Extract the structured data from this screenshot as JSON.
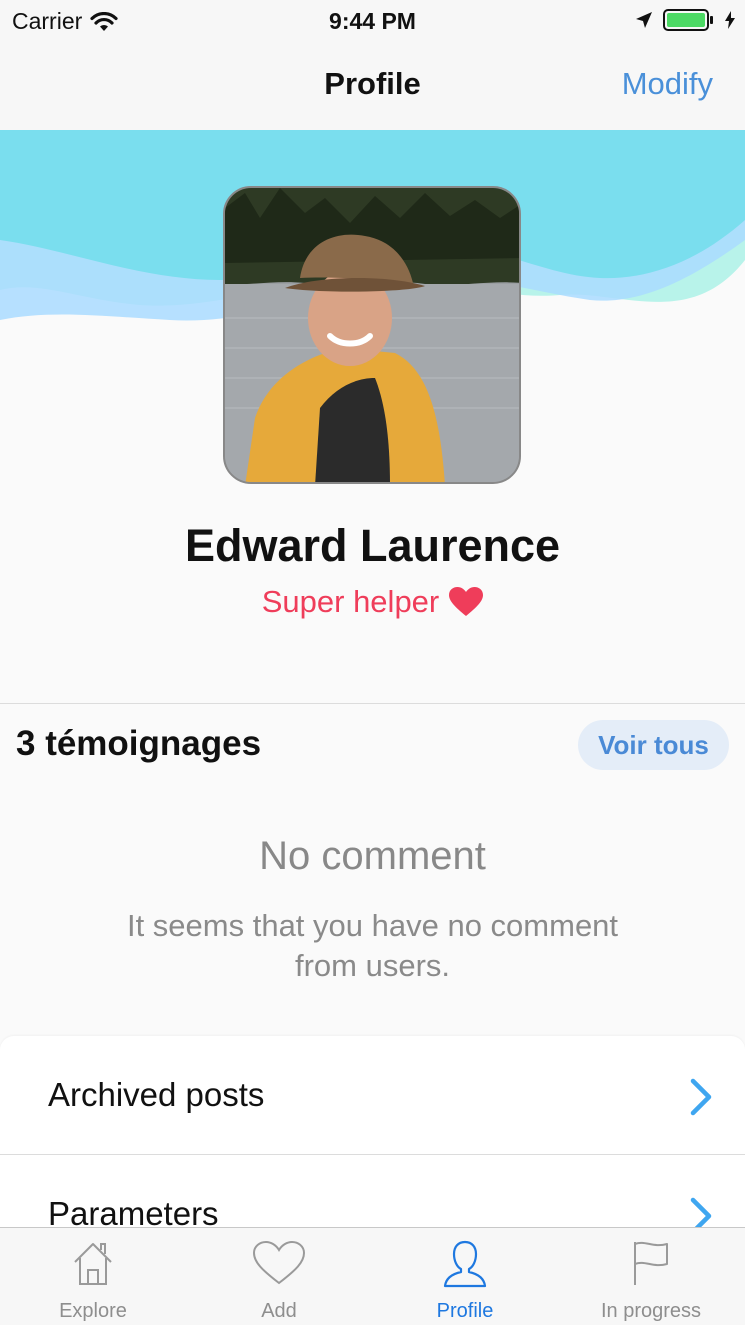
{
  "status_bar": {
    "carrier": "Carrier",
    "time": "9:44 PM"
  },
  "nav": {
    "title": "Profile",
    "action_label": "Modify"
  },
  "profile": {
    "name": "Edward Laurence",
    "status": "Super helper"
  },
  "testimonials": {
    "title": "3 témoignages",
    "see_all_label": "Voir tous",
    "empty_title": "No comment",
    "empty_text": "It seems that you have no comment from users."
  },
  "menu": {
    "items": [
      {
        "label": "Archived posts",
        "icon": "chevron-right-icon"
      },
      {
        "label": "Parameters",
        "icon": "chevron-right-icon"
      }
    ]
  },
  "tab_bar": {
    "tabs": [
      {
        "label": "Explore",
        "icon": "house-icon",
        "active": false
      },
      {
        "label": "Add",
        "icon": "heart-icon",
        "active": false
      },
      {
        "label": "Profile",
        "icon": "person-icon",
        "active": true
      },
      {
        "label": "In progress",
        "icon": "flag-icon",
        "active": false
      }
    ]
  },
  "colors": {
    "accent": "#4a90d9",
    "status_red": "#ef3d5a",
    "wave_cyan": "#7adeee",
    "wave_blue": "#a9dbff",
    "wave_mint": "#b8f3ea",
    "tab_active": "#1e78e0",
    "battery_green": "#4cd964"
  }
}
